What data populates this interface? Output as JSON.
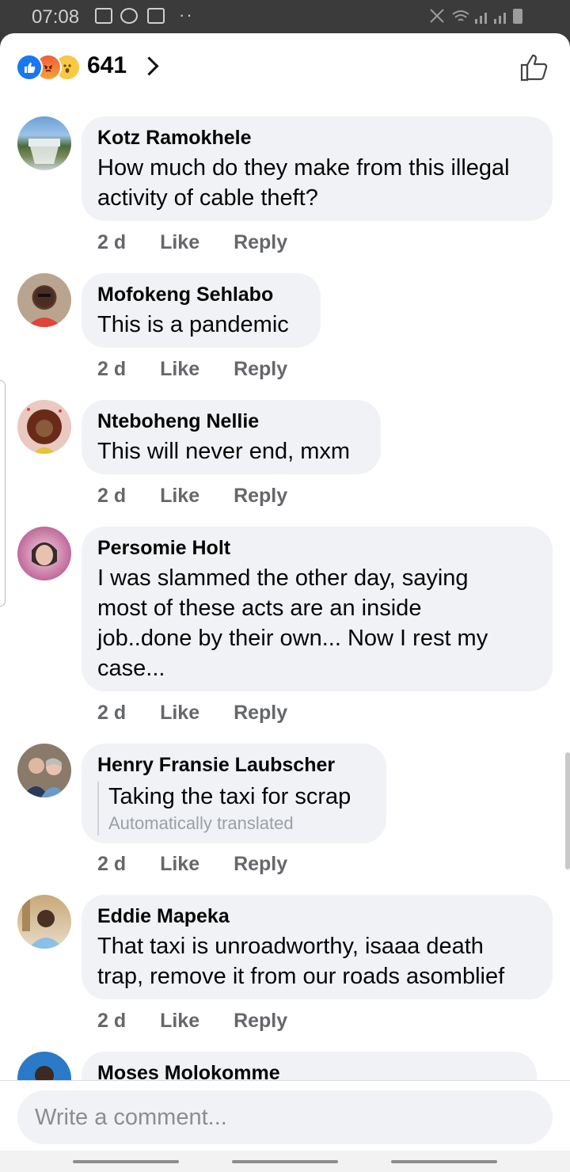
{
  "status": {
    "time": "07:08",
    "dots": "··"
  },
  "header": {
    "reaction_count": "641"
  },
  "comments": [
    {
      "author": "Kotz Ramokhele",
      "lines": [
        "How much do they make from this illegal",
        "activity of cable theft?"
      ],
      "time": "2 d",
      "like": "Like",
      "reply": "Reply"
    },
    {
      "author": "Mofokeng Sehlabo",
      "lines": [
        "This is a pandemic"
      ],
      "time": "2 d",
      "like": "Like",
      "reply": "Reply"
    },
    {
      "author": "Nteboheng Nellie",
      "lines": [
        "This will never end, mxm"
      ],
      "time": "2 d",
      "like": "Like",
      "reply": "Reply"
    },
    {
      "author": "Persomie Holt",
      "lines": [
        "I was slammed the other day, saying",
        "most of these acts are an inside",
        "job..done by their own... Now I rest my",
        "case..."
      ],
      "time": "2 d",
      "like": "Like",
      "reply": "Reply"
    },
    {
      "author": "Henry Fransie Laubscher",
      "lines": [
        "Taking the taxi for scrap"
      ],
      "translated_note": "Automatically translated",
      "time": "2 d",
      "like": "Like",
      "reply": "Reply"
    },
    {
      "author": "Eddie Mapeka",
      "lines": [
        "That taxi is unroadworthy, isaaa death",
        "trap, remove it from our roads asomblief"
      ],
      "time": "2 d",
      "like": "Like",
      "reply": "Reply"
    },
    {
      "author": "Moses Molokomme"
    }
  ],
  "compose": {
    "placeholder": "Write a comment..."
  }
}
